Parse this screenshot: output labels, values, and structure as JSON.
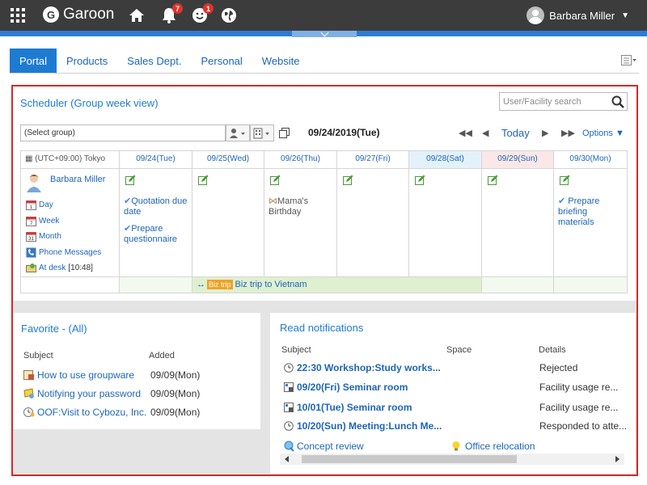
{
  "header": {
    "app_name": "Garoon",
    "logo_letter": "G",
    "notification_count": "7",
    "mention_count": "1",
    "user_name": "Barbara Miller"
  },
  "tabs": [
    {
      "label": "Portal",
      "active": true
    },
    {
      "label": "Products",
      "active": false
    },
    {
      "label": "Sales Dept.",
      "active": false
    },
    {
      "label": "Personal",
      "active": false
    },
    {
      "label": "Website",
      "active": false
    }
  ],
  "scheduler": {
    "title": "Scheduler (Group week view)",
    "search_placeholder": "User/Facility search",
    "group_select": "(Select group)",
    "date_label": "09/24/2019(Tue)",
    "today": "Today",
    "options": "Options",
    "timezone": "(UTC+09:00) Tokyo",
    "days": [
      {
        "label": "09/24(Tue)",
        "type": "weekday"
      },
      {
        "label": "09/25(Wed)",
        "type": "weekday"
      },
      {
        "label": "09/26(Thu)",
        "type": "weekday"
      },
      {
        "label": "09/27(Fri)",
        "type": "weekday"
      },
      {
        "label": "09/28(Sat)",
        "type": "sat"
      },
      {
        "label": "09/29(Sun)",
        "type": "sun"
      },
      {
        "label": "09/30(Mon)",
        "type": "weekday"
      }
    ],
    "user": {
      "name": "Barbara Miller",
      "links": [
        "Day",
        "Week",
        "Month",
        "Phone Messages",
        "At desk"
      ],
      "at_desk_time": "[10:48]"
    },
    "events": {
      "tue_1": "Quotation due date",
      "tue_2": "Prepare questionnaire",
      "thu_1": "Mama's Birthday",
      "mon_1": "Prepare briefing materials"
    },
    "biztrip_tag": "Biz trip",
    "biztrip_label": "Biz trip to Vietnam"
  },
  "favorite": {
    "title": "Favorite - (All)",
    "col_subject": "Subject",
    "col_added": "Added",
    "rows": [
      {
        "subject": "How to use groupware",
        "added": "09/09(Mon)"
      },
      {
        "subject": "Notifying your password",
        "added": "09/09(Mon)"
      },
      {
        "subject": "OOF:Visit to Cybozu, Inc.",
        "added": "09/09(Mon)"
      }
    ]
  },
  "notifications": {
    "title": "Read notifications",
    "col_subject": "Subject",
    "col_space": "Space",
    "col_details": "Details",
    "rows": [
      {
        "subject": "22:30 Workshop:Study works...",
        "details": "Rejected"
      },
      {
        "subject": "09/20(Fri) Seminar room",
        "details": "Facility usage re..."
      },
      {
        "subject": "10/01(Tue) Seminar room",
        "details": "Facility usage re..."
      },
      {
        "subject": "10/20(Sun) Meeting:Lunch Me...",
        "details": "Responded to atte..."
      }
    ],
    "footer": [
      "Concept review",
      "Office relocation"
    ]
  }
}
